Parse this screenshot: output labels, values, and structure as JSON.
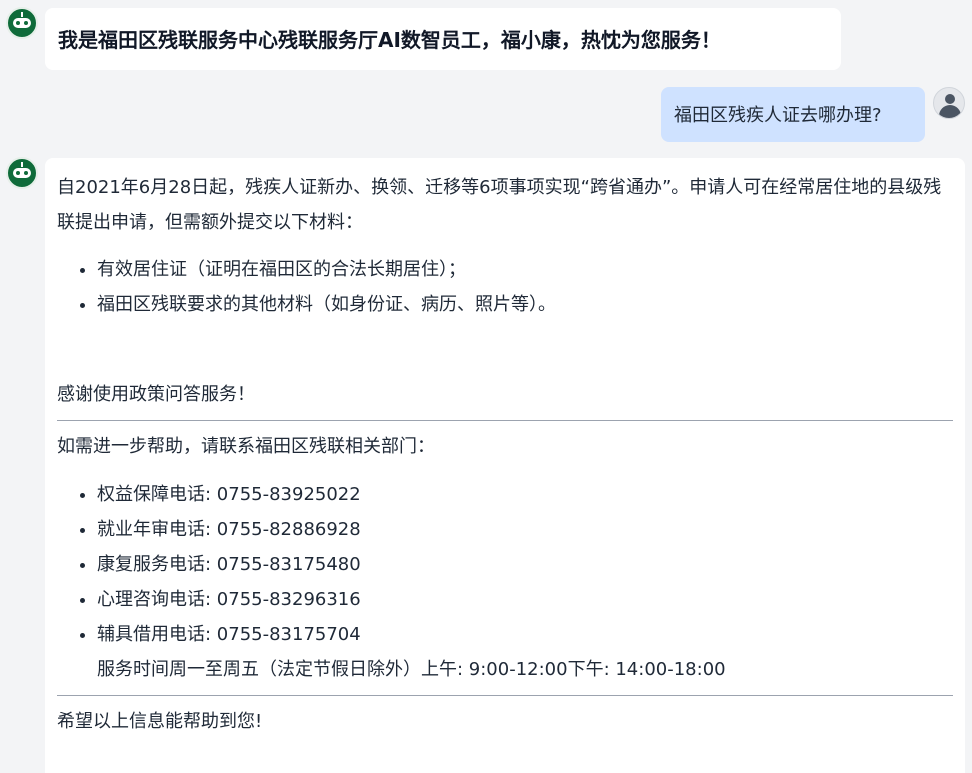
{
  "chat": {
    "greeting": "我是福田区残联服务中心残联服务厅AI数智员工，福小康，热忱为您服务！",
    "user_question": "福田区残疾人证去哪办理?",
    "answer": {
      "intro": "自2021年6月28日起，残疾人证新办、换领、迁移等6项事项实现“跨省通办”。申请人可在经常居住地的县级残联提出申请，但需额外提交以下材料：",
      "materials": [
        "有效居住证（证明在福田区的合法长期居住）；",
        "福田区残联要求的其他材料（如身份证、病历、照片等）。"
      ],
      "thanks": "感谢使用政策问答服务！",
      "help_intro": "如需进一步帮助，请联系福田区残联相关部门：",
      "contacts": [
        "权益保障电话: 0755-83925022",
        "就业年审电话: 0755-82886928",
        "康复服务电话: 0755-83175480",
        "心理咨询电话: 0755-83296316",
        "辅具借用电话: 0755-83175704"
      ],
      "hours": "服务时间周一至周五（法定节假日除外）上午: 9:00-12:00下午: 14:00-18:00",
      "closing": "希望以上信息能帮助到您!"
    }
  },
  "icons": {
    "bot_avatar": "robot-icon",
    "user_avatar": "user-icon"
  },
  "colors": {
    "background": "#f3f4f6",
    "bot_bubble": "#ffffff",
    "user_bubble": "#cfe2ff",
    "bot_avatar": "#0f6b3a"
  }
}
